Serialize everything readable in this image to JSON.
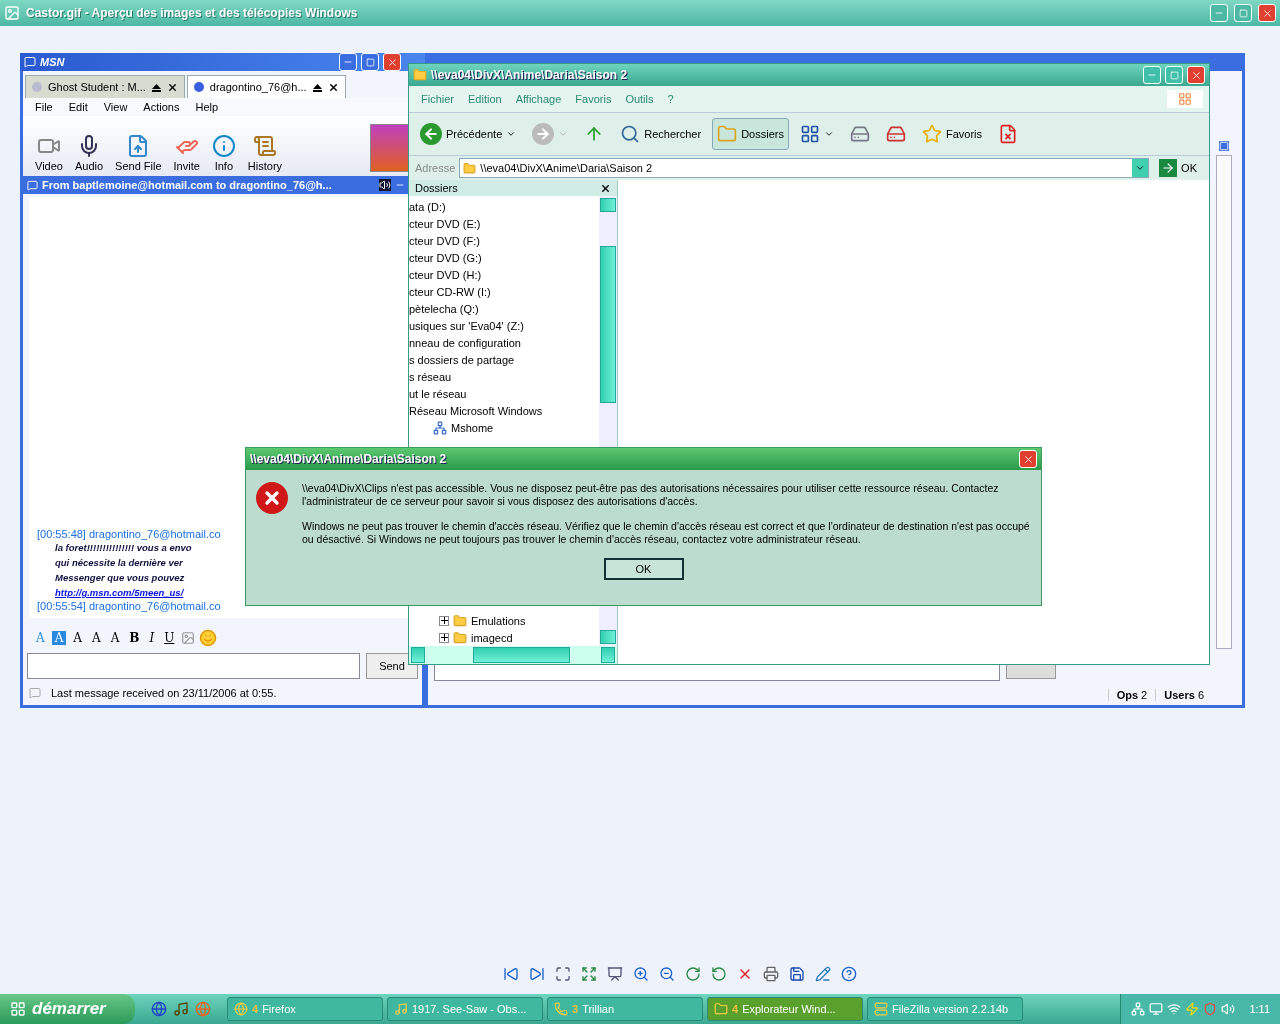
{
  "viewer": {
    "title": "Castor.gif - Aperçu des images et des télécopies Windows"
  },
  "msn": {
    "title": "MSN",
    "tabs": [
      {
        "label": "Ghost Student : M...",
        "selected": false
      },
      {
        "label": "dragontino_76@h...",
        "selected": true
      }
    ],
    "menu": [
      "File",
      "Edit",
      "View",
      "Actions",
      "Help"
    ],
    "toolbar": [
      {
        "kind": "video",
        "label": "Video"
      },
      {
        "kind": "audio",
        "label": "Audio"
      },
      {
        "kind": "send-file",
        "label": "Send File"
      },
      {
        "kind": "invite",
        "label": "Invite"
      },
      {
        "kind": "info",
        "label": "Info"
      },
      {
        "kind": "history",
        "label": "History"
      }
    ],
    "conversation_title": "From baptlemoine@hotmail.com to dragontino_76@h...",
    "messages": [
      {
        "time": "[00:55:48]",
        "sender": "dragontino_76@hotmail.co",
        "lines": [
          {
            "kind": "text",
            "text": "la foret!!!!!!!!!!!!!!! vous a envo"
          },
          {
            "kind": "text",
            "text": "qui nécessite la dernière ver"
          },
          {
            "kind": "text",
            "text": "Messenger que vous pouvez"
          },
          {
            "kind": "link",
            "text": "http://g.msn.com/5meen_us/"
          }
        ]
      },
      {
        "time": "[00:55:54]",
        "sender": "dragontino_76@hotmail.co"
      }
    ],
    "format_buttons": [
      {
        "kind": "font-color",
        "label": "A"
      },
      {
        "kind": "background",
        "label": "A"
      },
      {
        "kind": "smaller",
        "label": "A"
      },
      {
        "kind": "normal",
        "label": "A"
      },
      {
        "kind": "larger",
        "label": "A"
      },
      {
        "kind": "bold",
        "label": "B"
      },
      {
        "kind": "italic",
        "label": "I"
      },
      {
        "kind": "underline",
        "label": "U"
      }
    ],
    "send_button": "Send",
    "status": "Last message received on 23/11/2006 at 0:55."
  },
  "chat_window": {
    "status": [
      {
        "label": "Ops",
        "value": "2"
      },
      {
        "label": "Users",
        "value": "6"
      }
    ]
  },
  "explorer": {
    "title": "\\\\eva04\\DivX\\Anime\\Daria\\Saison 2",
    "menu": [
      "Fichier",
      "Edition",
      "Affichage",
      "Favoris",
      "Outils",
      "?"
    ],
    "toolbar": [
      {
        "kind": "back",
        "label": "Précédente",
        "selected": false
      },
      {
        "kind": "forward",
        "selected": false
      },
      {
        "kind": "up",
        "selected": false
      },
      {
        "kind": "search",
        "label": "Rechercher",
        "selected": false
      },
      {
        "kind": "folders",
        "label": "Dossiers",
        "selected": true
      },
      {
        "kind": "views",
        "selected": false
      },
      {
        "kind": "map-drive",
        "selected": false
      },
      {
        "kind": "disconnect-drive",
        "selected": false
      },
      {
        "kind": "favorites",
        "label": "Favoris",
        "selected": false
      },
      {
        "kind": "close-doc",
        "selected": false
      }
    ],
    "address_label": "Adresse",
    "address": "\\\\eva04\\DivX\\Anime\\Daria\\Saison 2",
    "go_button": "OK",
    "folders": {
      "title": "Dossiers",
      "items": [
        {
          "label": "ata (D:)"
        },
        {
          "label": "cteur DVD (E:)"
        },
        {
          "label": "cteur DVD (F:)"
        },
        {
          "label": "cteur DVD (G:)"
        },
        {
          "label": "cteur DVD (H:)"
        },
        {
          "label": "cteur CD-RW (I:)"
        },
        {
          "label": "pètelecha (Q:)"
        },
        {
          "label": "usiques sur 'Eva04' (Z:)"
        },
        {
          "label": "nneau de configuration"
        },
        {
          "label": "s dossiers de partage"
        },
        {
          "label": "s réseau"
        },
        {
          "label": "ut le réseau"
        },
        {
          "label": "Réseau Microsoft Windows",
          "children": [
            {
              "label": "Mshome"
            }
          ]
        }
      ],
      "lower_items": [
        {
          "label": "Emulations",
          "expanded": false
        },
        {
          "label": "imagecd",
          "expanded": false
        }
      ]
    }
  },
  "dialog": {
    "title": "\\\\eva04\\DivX\\Anime\\Daria\\Saison 2",
    "paragraphs": [
      "\\\\eva04\\DivX\\Clips n'est pas accessible. Vous ne disposez peut-être pas des autorisations nécessaires pour utiliser cette ressource réseau. Contactez l'administrateur de ce serveur pour savoir si vous disposez des autorisations d'accès.",
      "Windows ne peut pas trouver le chemin d'accès réseau. Vérifiez que le chemin d'accès réseau est correct et que l'ordinateur de destination n'est pas occupé ou désactivé. Si Windows ne peut toujours pas trouver le chemin d'accès réseau, contactez votre administrateur réseau."
    ],
    "ok_button": "OK"
  },
  "viewer_toolbar": [
    {
      "kind": "previous"
    },
    {
      "kind": "next"
    },
    {
      "kind": "best-fit"
    },
    {
      "kind": "actual-size"
    },
    {
      "kind": "slideshow"
    },
    {
      "kind": "zoom-in"
    },
    {
      "kind": "zoom-out"
    },
    {
      "kind": "rotate-right"
    },
    {
      "kind": "rotate-left"
    },
    {
      "kind": "delete"
    },
    {
      "kind": "print"
    },
    {
      "kind": "save"
    },
    {
      "kind": "edit"
    },
    {
      "kind": "help"
    }
  ],
  "taskbar": {
    "start": "démarrer",
    "tasks": [
      {
        "kind": "firefox",
        "count": "4",
        "label": "Firefox",
        "selected": false
      },
      {
        "kind": "music",
        "label": "1917. See-Saw - Obs...",
        "selected": false
      },
      {
        "kind": "trillian",
        "count": "3",
        "label": "Trillian",
        "selected": false
      },
      {
        "kind": "folder",
        "count": "4",
        "label": "Explorateur Wind...",
        "selected": true
      },
      {
        "kind": "filezilla",
        "label": "FileZilla version 2.2.14b",
        "selected": false
      }
    ],
    "clock": "1:11"
  }
}
